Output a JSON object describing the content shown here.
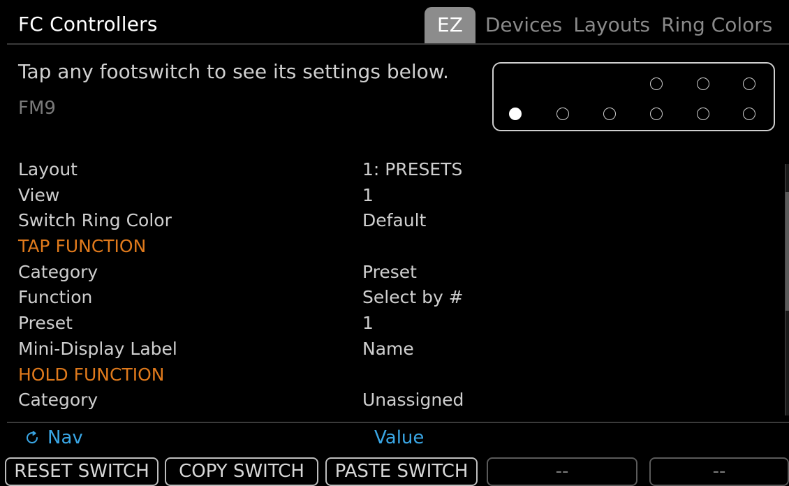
{
  "app": {
    "title": "FC Controllers"
  },
  "tabs": [
    {
      "label": "EZ",
      "active": true
    },
    {
      "label": "Devices",
      "active": false
    },
    {
      "label": "Layouts",
      "active": false
    },
    {
      "label": "Ring Colors",
      "active": false
    }
  ],
  "instruction": "Tap any footswitch to see its settings below.",
  "device": "FM9",
  "footswitches": {
    "top_row_count": 3,
    "bottom_row_count": 6,
    "selected": "bottom-1"
  },
  "params": [
    {
      "label": "Layout",
      "value": "1: PRESETS",
      "section": false
    },
    {
      "label": "View",
      "value": "1",
      "section": false
    },
    {
      "label": "Switch Ring Color",
      "value": "Default",
      "section": false
    },
    {
      "label": "TAP FUNCTION",
      "value": "",
      "section": true
    },
    {
      "label": "Category",
      "value": "Preset",
      "section": false
    },
    {
      "label": "Function",
      "value": "Select by #",
      "section": false
    },
    {
      "label": "Preset",
      "value": "1",
      "section": false
    },
    {
      "label": "Mini-Display Label",
      "value": "Name",
      "section": false
    },
    {
      "label": "HOLD FUNCTION",
      "value": "",
      "section": true
    },
    {
      "label": "Category",
      "value": "Unassigned",
      "section": false
    }
  ],
  "hints": {
    "nav_icon": "rotate-knob-icon",
    "nav": "Nav",
    "value": "Value"
  },
  "softkeys": [
    {
      "label": "RESET SWITCH"
    },
    {
      "label": "COPY SWITCH"
    },
    {
      "label": "PASTE SWITCH"
    },
    {
      "label": "--"
    },
    {
      "label": "--"
    }
  ],
  "colors": {
    "section_heading": "#e07a1c",
    "hint_text": "#3aa7e6",
    "active_tab": "#8c8c8c"
  }
}
